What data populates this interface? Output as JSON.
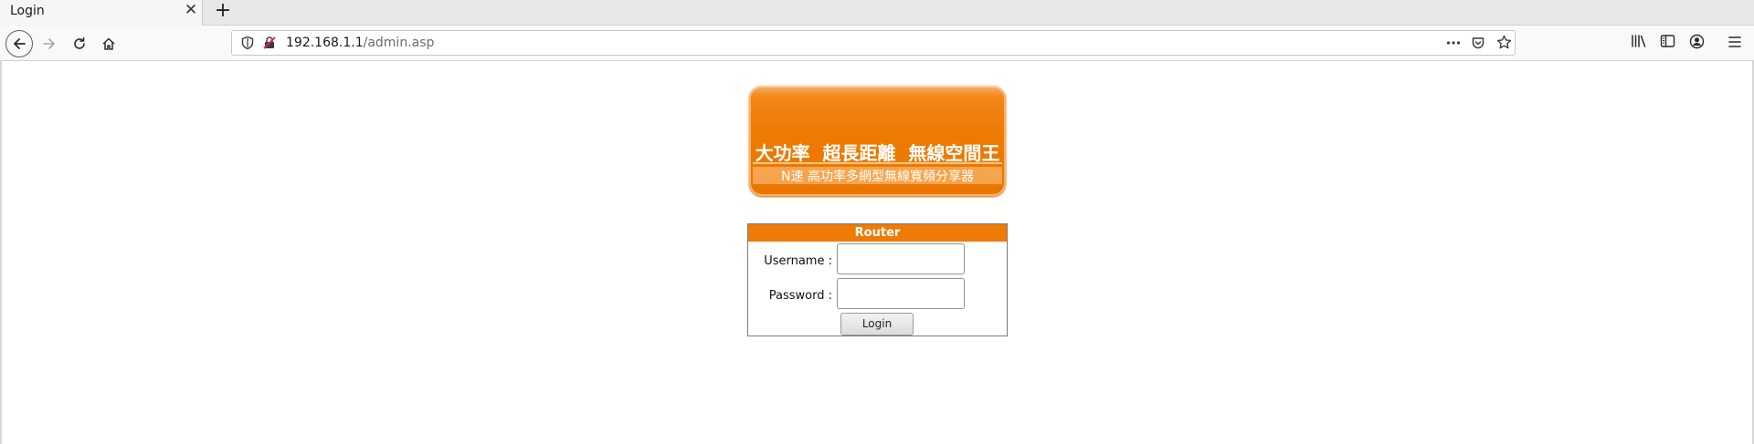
{
  "tab": {
    "title": "Login",
    "close_icon": "close-icon",
    "new_tab_icon": "plus-icon"
  },
  "nav": {
    "back_icon": "arrow-left-icon",
    "forward_icon": "arrow-right-icon",
    "reload_icon": "reload-icon",
    "home_icon": "home-icon"
  },
  "urlbar": {
    "host": "192.168.1.1",
    "path": "/admin.asp",
    "shield_icon": "shield-icon",
    "insecure_icon": "insecure-lock-icon",
    "more_icon": "more-dots-icon",
    "pocket_icon": "pocket-icon",
    "bookmark_icon": "star-icon"
  },
  "toolbar": {
    "library_icon": "library-icon",
    "sidebar_icon": "sidebar-icon",
    "account_icon": "account-icon",
    "menu_icon": "hamburger-menu-icon"
  },
  "banner": {
    "main_text": "大功率  超長距離  無線空間王",
    "sub_text": "N速 高功率多網型無線寬頻分享器",
    "color": "#ee7b05"
  },
  "login": {
    "header": "Router",
    "username_label": "Username :",
    "username_value": "",
    "password_label": "Password :",
    "password_value": "",
    "button_label": "Login"
  }
}
